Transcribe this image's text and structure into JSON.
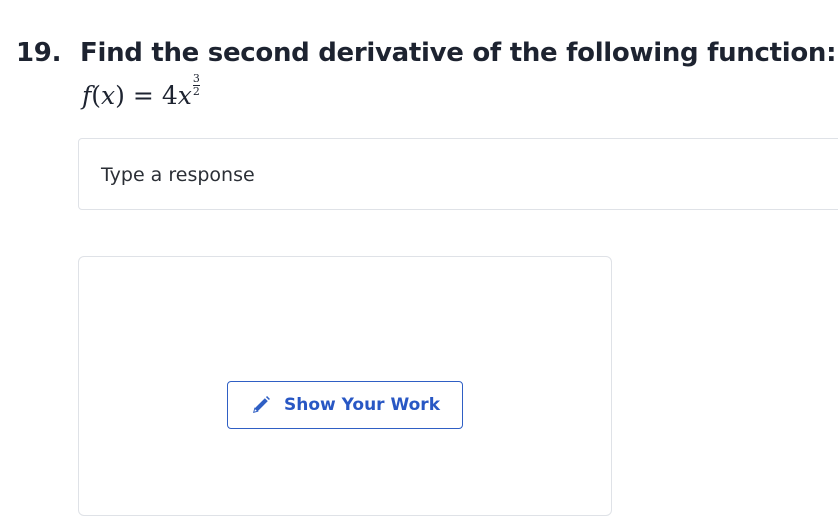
{
  "question": {
    "number": "19.",
    "prompt": "Find the second derivative of the following function:",
    "equation": {
      "function_name": "f",
      "variable": "x",
      "equals": "=",
      "coefficient": "4",
      "exponent_numerator": "3",
      "exponent_denominator": "2"
    }
  },
  "response": {
    "placeholder": "Type a response"
  },
  "work": {
    "button_label": "Show Your Work",
    "button_icon": "pencil-icon",
    "accent_color": "#2f5fc4"
  }
}
